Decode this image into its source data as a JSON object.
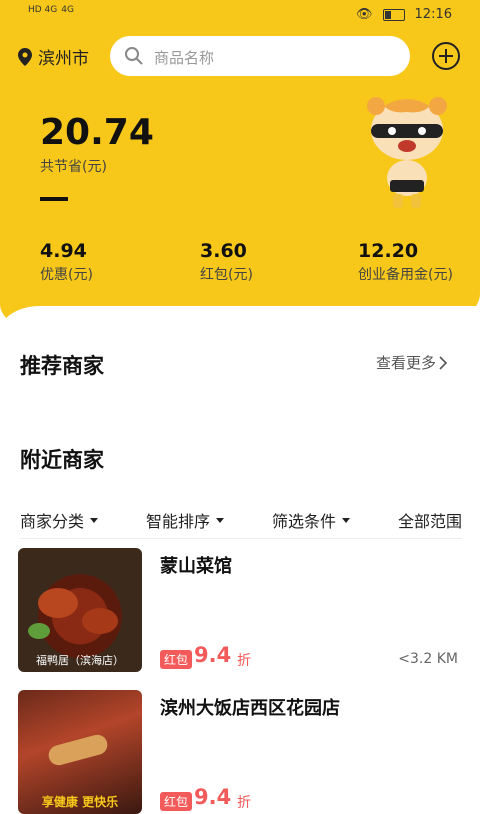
{
  "status_bar": {
    "time": "12:16",
    "signal_left": "HD 4G",
    "signal_right": "4G"
  },
  "header": {
    "city": "滨州市",
    "search_placeholder": "商品名称"
  },
  "savings": {
    "total": "20.74",
    "total_label": "共节省(元)"
  },
  "stats": [
    {
      "value": "4.94",
      "label": "优惠(元)"
    },
    {
      "value": "3.60",
      "label": "红包(元)"
    },
    {
      "value": "12.20",
      "label": "创业备用金(元)"
    }
  ],
  "recommended": {
    "title": "推荐商家",
    "more_label": "查看更多"
  },
  "nearby": {
    "title": "附近商家"
  },
  "filters": [
    {
      "label": "商家分类"
    },
    {
      "label": "智能排序"
    },
    {
      "label": "筛选条件"
    },
    {
      "label": "全部范围"
    }
  ],
  "shops": [
    {
      "name": "蒙山菜馆",
      "badge": "红包",
      "discount": "9.4",
      "discount_unit": "折",
      "distance": "<3.2 KM",
      "thumb_caption": "福鸭居（滨海店）"
    },
    {
      "name": "滨州大饭店西区花园店",
      "badge": "红包",
      "discount": "9.4",
      "discount_unit": "折",
      "distance": "",
      "thumb_caption": "享健康 更快乐"
    }
  ],
  "colors": {
    "brand_yellow": "#f7c81a",
    "accent_red": "#f35a5a"
  }
}
